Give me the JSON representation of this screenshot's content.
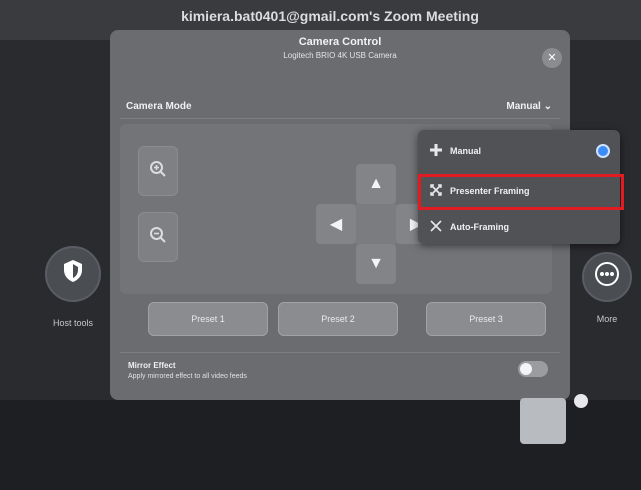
{
  "meeting_title": "kimiera.bat0401@gmail.com's Zoom Meeting",
  "left_side_button": {
    "label": "Host tools",
    "icon": "shield-icon"
  },
  "right_side_button": {
    "label": "More",
    "icon": "more-icon"
  },
  "panel": {
    "title": "Camera Control",
    "subtitle": "Logitech BRIO 4K USB Camera",
    "close_icon": "close-icon"
  },
  "camera_mode": {
    "label": "Camera Mode",
    "selected": "Manual ⌄"
  },
  "zoom": {
    "in_icon": "zoom-in-icon",
    "out_icon": "zoom-out-icon"
  },
  "dpad": {
    "up": "▲",
    "down": "▼",
    "left": "◀",
    "right": "▶"
  },
  "presets": [
    "Preset 1",
    "Preset 2",
    "Preset 3"
  ],
  "mirror": {
    "title": "Mirror Effect",
    "description": "Apply mirrored effect to all video feeds",
    "enabled": false
  },
  "dropdown": {
    "items": [
      {
        "label": "Manual",
        "icon": "plus-icon",
        "selected": true
      },
      {
        "label": "Presenter Framing",
        "icon": "expand-icon",
        "selected": false
      },
      {
        "label": "Auto-Framing",
        "icon": "auto-frame-icon",
        "selected": false
      }
    ]
  },
  "colors": {
    "highlight": "#e11b22",
    "accent": "#3b8df5"
  }
}
